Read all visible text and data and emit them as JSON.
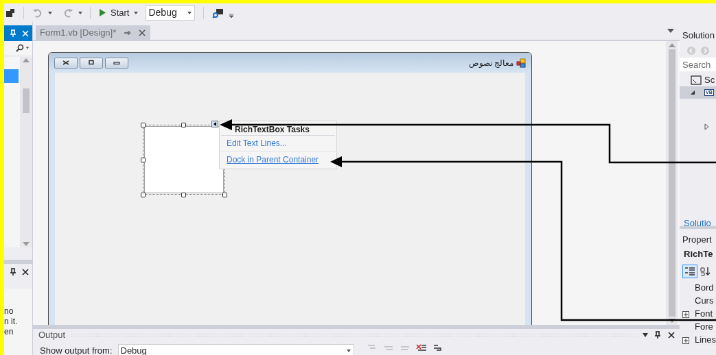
{
  "toolbar": {
    "run_button": "Start",
    "configuration": "Debug"
  },
  "left_panel": {
    "text_lines": [
      "no",
      "n it.",
      "en"
    ]
  },
  "document_tabs": [
    {
      "label": "Form1.vb [Design]*",
      "selected": true
    }
  ],
  "form": {
    "title": "معالج نصوص"
  },
  "smart_tag": {
    "title": "RichTextBox Tasks",
    "actions": [
      "Edit Text Lines...",
      "Dock in Parent Container"
    ]
  },
  "output": {
    "title": "Output",
    "label": "Show output from:",
    "source": "Debug"
  },
  "solution_explorer": {
    "title": "Solution",
    "search_placeholder": "Search",
    "items": [
      {
        "kind": "solution",
        "label": "Sc",
        "selected": false
      },
      {
        "kind": "project",
        "icon_text": "VB",
        "selected": true
      }
    ],
    "footer_tab": "Solutio"
  },
  "properties": {
    "title": "Propert",
    "object": "RichTe",
    "rows": [
      {
        "name": "Bord",
        "expandable": false
      },
      {
        "name": "Curs",
        "expandable": false
      },
      {
        "name": "Font",
        "expandable": true
      },
      {
        "name": "Fore",
        "expandable": false
      },
      {
        "name": "Lines",
        "expandable": true
      }
    ]
  }
}
